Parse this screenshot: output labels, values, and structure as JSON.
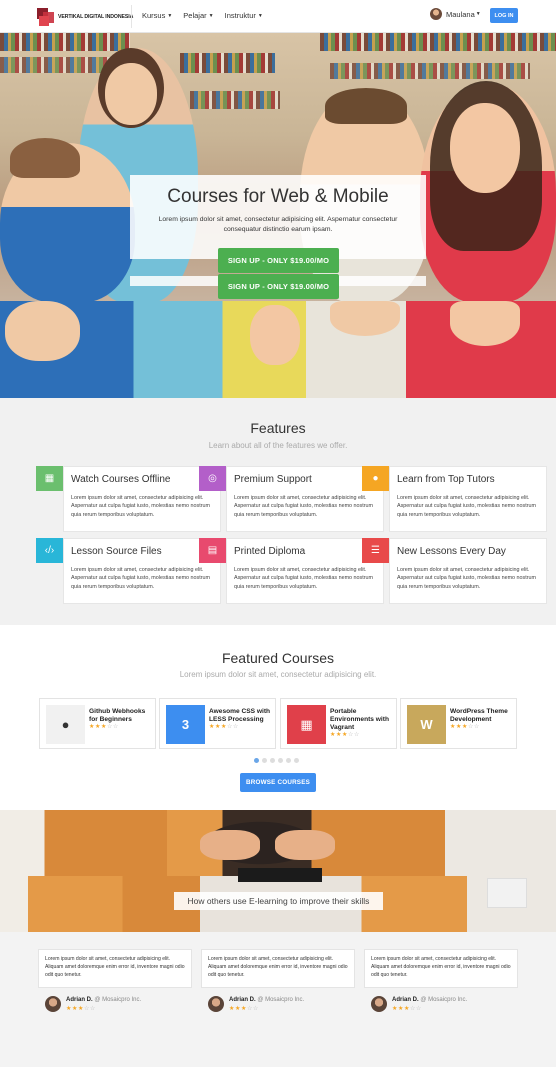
{
  "navbar": {
    "brand": "VERTIKAL DIGITAL INDONESIA",
    "menu": [
      "Kursus",
      "Pelajar",
      "Instruktur"
    ],
    "user_name": "Maulana",
    "login_label": "LOG IN"
  },
  "hero": {
    "title": "Courses for Web & Mobile",
    "subtitle": "Lorem ipsum dolor sit amet, consectetur adipisicing elit. Aspernatur consectetur consequatur distinctio earum ipsam.",
    "signup_label": "SIGN UP - ONLY $19.00/MO"
  },
  "features": {
    "title": "Features",
    "subtitle": "Learn about all of the features we offer.",
    "items": [
      {
        "title": "Watch Courses Offline",
        "icon": "video-icon",
        "color": "#6bbf6e"
      },
      {
        "title": "Premium Support",
        "icon": "lifebuoy-icon",
        "color": "#b35fc9"
      },
      {
        "title": "Learn from Top Tutors",
        "icon": "person-icon",
        "color": "#f5a623"
      },
      {
        "title": "Lesson Source Files",
        "icon": "code-icon",
        "color": "#29b6d8"
      },
      {
        "title": "Printed Diploma",
        "icon": "printer-icon",
        "color": "#e84a6e"
      },
      {
        "title": "New Lessons Every Day",
        "icon": "list-icon",
        "color": "#e84a4a"
      }
    ],
    "desc": "Lorem ipsum dolor sit amet, consectetur adipisicing elit. Aspernatur aut culpa fugiat iusto, molestias nemo nostrum quia rerum temporibus voluptatum."
  },
  "courses": {
    "title": "Featured Courses",
    "subtitle": "Lorem ipsum dolor sit amet, consectetur adipisicing elit.",
    "items": [
      {
        "title": "Github Webhooks for Beginners",
        "icon": "github-icon",
        "color": "#f1f1f1",
        "rating": 3
      },
      {
        "title": "Awesome CSS with LESS Processing",
        "icon": "css3-icon",
        "color": "#3d8ef0",
        "rating": 3
      },
      {
        "title": "Portable Environments with Vagrant",
        "icon": "windows-icon",
        "color": "#e0404a",
        "rating": 3
      },
      {
        "title": "WordPress Theme Development",
        "icon": "wordpress-icon",
        "color": "#c8a85c",
        "rating": 3
      }
    ],
    "browse_label": "BROWSE COURSES",
    "pagination": {
      "pages": 6,
      "current": 1
    }
  },
  "testimonials": {
    "banner_caption": "How others use E-learning to improve their skills",
    "items": [
      {
        "quote": "Lorem ipsum dolor sit amet, consectetur adipisicing elit. Aliquam amet doloremque enim error id, inventore magni odio odit quo tenetur.",
        "name": "Adrian D.",
        "org": "@ Mosaicpro Inc.",
        "rating": 3
      },
      {
        "quote": "Lorem ipsum dolor sit amet, consectetur adipisicing elit. Aliquam amet doloremque enim error id, inventore magni odio odit quo tenetur.",
        "name": "Adrian D.",
        "org": "@ Mosaicpro Inc.",
        "rating": 3
      },
      {
        "quote": "Lorem ipsum dolor sit amet, consectetur adipisicing elit. Aliquam amet doloremque enim error id, inventore magni odio odit quo tenetur.",
        "name": "Adrian D.",
        "org": "@ Mosaicpro Inc.",
        "rating": 3
      }
    ]
  }
}
